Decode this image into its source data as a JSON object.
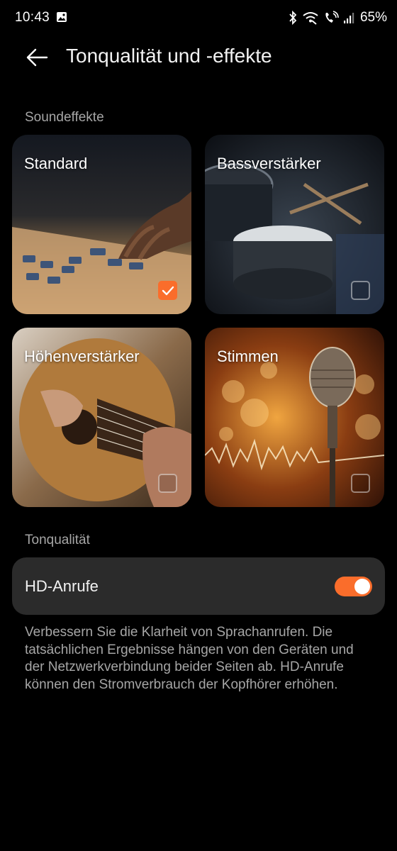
{
  "status_bar": {
    "time": "10:43",
    "battery": "65%",
    "icons": [
      "gallery-icon",
      "bluetooth-icon",
      "wifi-call-icon",
      "volte-call-icon",
      "signal-icon"
    ]
  },
  "header": {
    "title": "Tonqualität und -effekte",
    "back_icon": "arrow-left-icon"
  },
  "sound_effects": {
    "section_label": "Soundeffekte",
    "items": [
      {
        "label": "Standard",
        "selected": true
      },
      {
        "label": "Bassverstärker",
        "selected": false
      },
      {
        "label": "Höhenverstärker",
        "selected": false
      },
      {
        "label": "Stimmen",
        "selected": false
      }
    ]
  },
  "sound_quality": {
    "section_label": "Tonqualität",
    "hd_calls": {
      "label": "HD-Anrufe",
      "enabled": true
    },
    "description": "Verbessern Sie die Klarheit von Sprachanrufen. Die tatsächlichen Ergebnisse hängen von den Geräten und der Netzwerkverbindung beider Seiten ab. HD-Anrufe können den Stromverbrauch der Kopfhörer erhöhen."
  },
  "colors": {
    "accent": "#fa6d2b",
    "background": "#000000",
    "card": "#2b2b2b",
    "secondary_text": "#a6a6a6"
  }
}
